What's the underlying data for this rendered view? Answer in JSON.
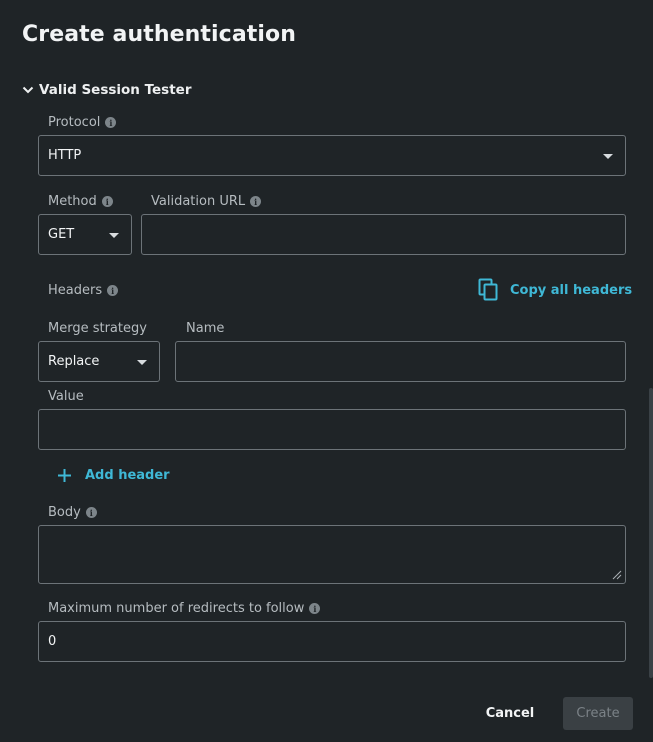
{
  "dialog": {
    "title": "Create authentication",
    "section_title": "Valid Session Tester"
  },
  "form": {
    "protocol": {
      "label": "Protocol",
      "value": "HTTP"
    },
    "method": {
      "label": "Method",
      "value": "GET"
    },
    "validation_url": {
      "label": "Validation URL",
      "value": ""
    },
    "headers": {
      "label": "Headers",
      "copy_all_label": "Copy all headers"
    },
    "merge_strategy": {
      "label": "Merge strategy",
      "value": "Replace"
    },
    "name": {
      "label": "Name",
      "value": ""
    },
    "value": {
      "label": "Value",
      "value": ""
    },
    "add_header_label": "Add header",
    "body": {
      "label": "Body",
      "value": ""
    },
    "max_redirects": {
      "label": "Maximum number of redirects to follow",
      "value": "0"
    }
  },
  "footer": {
    "cancel_label": "Cancel",
    "create_label": "Create"
  },
  "colors": {
    "background": "#1f2427",
    "accent": "#3fb8d6",
    "border": "#6c7378",
    "disabled_button": "#3a4044"
  },
  "icons": [
    "chevron-down-icon",
    "info-icon",
    "caret-down-icon",
    "copy-icon",
    "plus-icon",
    "resize-grip-icon"
  ]
}
